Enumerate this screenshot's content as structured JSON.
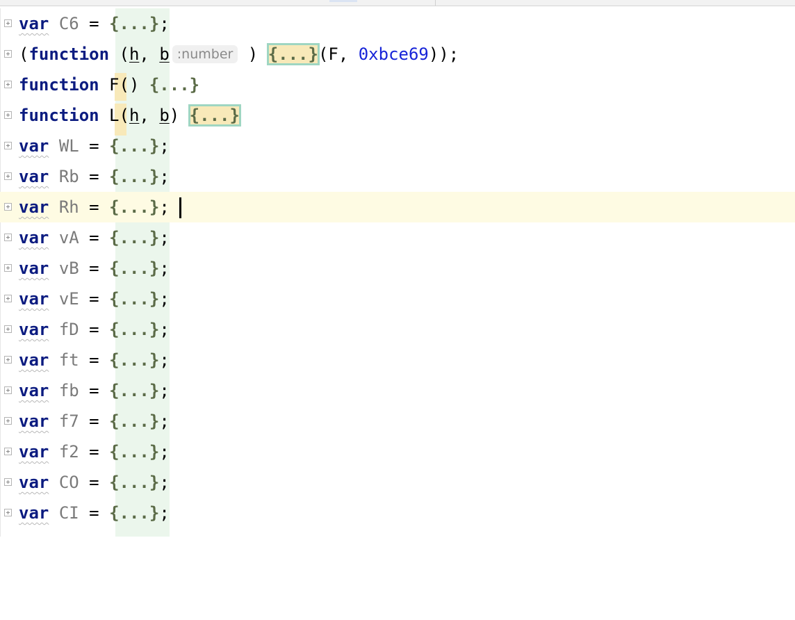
{
  "editor": {
    "lines": [
      {
        "kind": "var",
        "keyword": "var",
        "name": "C6",
        "eq": "=",
        "body": "{...}",
        "end": ";"
      },
      {
        "kind": "iife",
        "open": "(",
        "keyword": "function",
        "p_open": "(",
        "p1": "h",
        "sep": ",",
        "p2": "b",
        "hint": ":number",
        "p_close": ")",
        "body": "{...}",
        "args": "(F, ",
        "num": "0xbce69",
        "end": "));"
      },
      {
        "kind": "func",
        "keyword": "function",
        "name": "F",
        "params": "()",
        "body": "{...}"
      },
      {
        "kind": "func2",
        "keyword": "function",
        "name": "L",
        "p_open": "(",
        "p1": "h",
        "sep": ",",
        "p2": "b",
        "p_close": ")",
        "body": "{...}"
      },
      {
        "kind": "var",
        "keyword": "var",
        "name": "WL",
        "eq": "=",
        "body": "{...}",
        "end": ";"
      },
      {
        "kind": "var",
        "keyword": "var",
        "name": "Rb",
        "eq": "=",
        "body": "{...}",
        "end": ";"
      },
      {
        "kind": "var",
        "keyword": "var",
        "name": "Rh",
        "eq": "=",
        "body": "{...}",
        "end": ";"
      },
      {
        "kind": "var",
        "keyword": "var",
        "name": "vA",
        "eq": "=",
        "body": "{...}",
        "end": ";"
      },
      {
        "kind": "var",
        "keyword": "var",
        "name": "vB",
        "eq": "=",
        "body": "{...}",
        "end": ";"
      },
      {
        "kind": "var",
        "keyword": "var",
        "name": "vE",
        "eq": "=",
        "body": "{...}",
        "end": ";"
      },
      {
        "kind": "var",
        "keyword": "var",
        "name": "fD",
        "eq": "=",
        "body": "{...}",
        "end": ";"
      },
      {
        "kind": "var",
        "keyword": "var",
        "name": "ft",
        "eq": "=",
        "body": "{...}",
        "end": ";"
      },
      {
        "kind": "var",
        "keyword": "var",
        "name": "fb",
        "eq": "=",
        "body": "{...}",
        "end": ";"
      },
      {
        "kind": "var",
        "keyword": "var",
        "name": "f7",
        "eq": "=",
        "body": "{...}",
        "end": ";"
      },
      {
        "kind": "var",
        "keyword": "var",
        "name": "f2",
        "eq": "=",
        "body": "{...}",
        "end": ";"
      },
      {
        "kind": "var",
        "keyword": "var",
        "name": "CO",
        "eq": "=",
        "body": "{...}",
        "end": ";"
      },
      {
        "kind": "var",
        "keyword": "var",
        "name": "CI",
        "eq": "=",
        "body": "{...}",
        "end": ";"
      }
    ]
  }
}
